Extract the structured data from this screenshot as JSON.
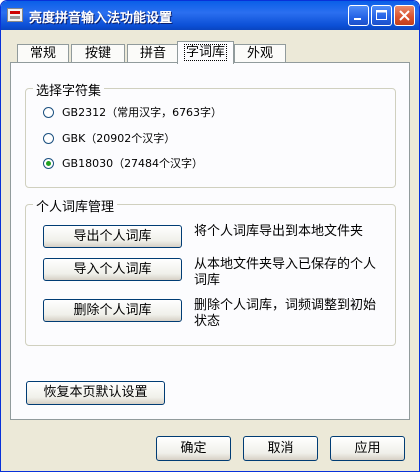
{
  "window": {
    "title": "亮度拼音输入法功能设置"
  },
  "tabs": [
    {
      "label": "常规"
    },
    {
      "label": "按键"
    },
    {
      "label": "拼音"
    },
    {
      "label": "字词库"
    },
    {
      "label": "外观"
    }
  ],
  "active_tab": "字词库",
  "charset_group": {
    "legend": "选择字符集",
    "options": [
      {
        "label": "GB2312（常用汉字，6763字）",
        "checked": false
      },
      {
        "label": "GBK（20902个汉字）",
        "checked": false
      },
      {
        "label": "GB18030（27484个汉字）",
        "checked": true
      }
    ]
  },
  "personal_dict_group": {
    "legend": "个人词库管理",
    "actions": [
      {
        "button": "导出个人词库",
        "description": "将个人词库导出到本地文件夹"
      },
      {
        "button": "导入个人词库",
        "description": "从本地文件夹导入已保存的个人词库"
      },
      {
        "button": "删除个人词库",
        "description": "删除个人词库，词频调整到初始状态"
      }
    ]
  },
  "restore_defaults_label": "恢复本页默认设置",
  "footer": {
    "ok_label": "确定",
    "cancel_label": "取消",
    "apply_label": "应用"
  }
}
